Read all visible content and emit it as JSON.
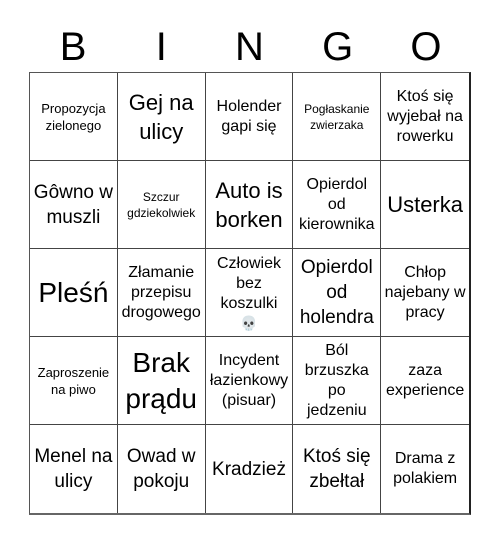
{
  "header": {
    "letters": [
      "B",
      "I",
      "N",
      "G",
      "O"
    ]
  },
  "cells": [
    {
      "text": "Propozycja zielonego",
      "size": "s-sm"
    },
    {
      "text": "Gej na ulicy",
      "size": "s-xl"
    },
    {
      "text": "Holender gapi się",
      "size": "s-md"
    },
    {
      "text": "Pogłaskanie zwierzaka",
      "size": "s-xs"
    },
    {
      "text": "Ktoś się wyjebał na rowerku",
      "size": "s-md"
    },
    {
      "text": "Gôwno w muszli",
      "size": "s-lg"
    },
    {
      "text": "Szczur gdziekolwiek",
      "size": "s-xs"
    },
    {
      "text": "Auto is borken",
      "size": "s-xl"
    },
    {
      "text": "Opierdol od kierownika",
      "size": "s-md"
    },
    {
      "text": "Usterka",
      "size": "s-xl"
    },
    {
      "text": "Pleśń",
      "size": "s-xxl"
    },
    {
      "text": "Złamanie przepisu drogowego",
      "size": "s-md"
    },
    {
      "text": "Człowiek bez koszulki",
      "size": "s-md",
      "emoji": "💀"
    },
    {
      "text": "Opierdol od holendra",
      "size": "s-lg"
    },
    {
      "text": "Chłop najebany w pracy",
      "size": "s-md"
    },
    {
      "text": "Zaproszenie na piwo",
      "size": "s-sm"
    },
    {
      "text": "Brak prądu",
      "size": "s-xxl"
    },
    {
      "text": "Incydent łazienkowy (pisuar)",
      "size": "s-md"
    },
    {
      "text": "Ból brzuszka po jedzeniu",
      "size": "s-md"
    },
    {
      "text": "zaza experience",
      "size": "s-md"
    },
    {
      "text": "Menel na ulicy",
      "size": "s-lg"
    },
    {
      "text": "Owad w pokoju",
      "size": "s-lg"
    },
    {
      "text": "Kradzież",
      "size": "s-lg"
    },
    {
      "text": "Ktoś się zbełtał",
      "size": "s-lg"
    },
    {
      "text": "Drama z polakiem",
      "size": "s-md"
    }
  ]
}
